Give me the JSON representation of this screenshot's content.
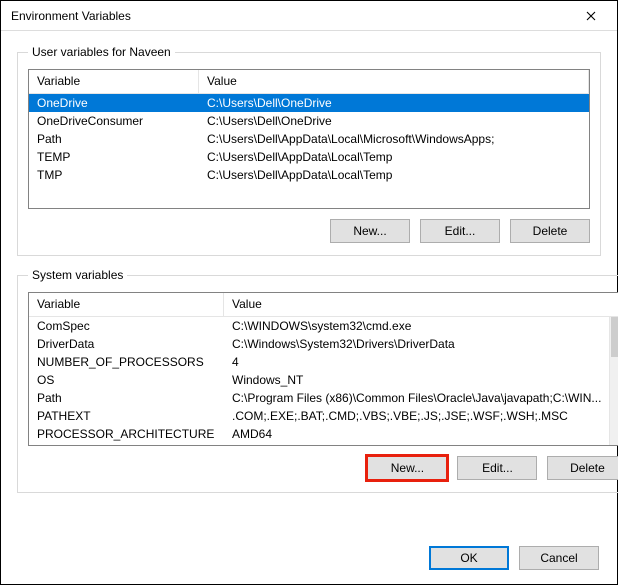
{
  "window": {
    "title": "Environment Variables"
  },
  "userGroup": {
    "legend": "User variables for Naveen",
    "headers": {
      "variable": "Variable",
      "value": "Value"
    },
    "rows": [
      {
        "variable": "OneDrive",
        "value": "C:\\Users\\Dell\\OneDrive",
        "selected": true
      },
      {
        "variable": "OneDriveConsumer",
        "value": "C:\\Users\\Dell\\OneDrive",
        "selected": false
      },
      {
        "variable": "Path",
        "value": "C:\\Users\\Dell\\AppData\\Local\\Microsoft\\WindowsApps;",
        "selected": false
      },
      {
        "variable": "TEMP",
        "value": "C:\\Users\\Dell\\AppData\\Local\\Temp",
        "selected": false
      },
      {
        "variable": "TMP",
        "value": "C:\\Users\\Dell\\AppData\\Local\\Temp",
        "selected": false
      }
    ],
    "buttons": {
      "new": "New...",
      "edit": "Edit...",
      "delete": "Delete"
    }
  },
  "systemGroup": {
    "legend": "System variables",
    "headers": {
      "variable": "Variable",
      "value": "Value"
    },
    "rows": [
      {
        "variable": "ComSpec",
        "value": "C:\\WINDOWS\\system32\\cmd.exe"
      },
      {
        "variable": "DriverData",
        "value": "C:\\Windows\\System32\\Drivers\\DriverData"
      },
      {
        "variable": "NUMBER_OF_PROCESSORS",
        "value": "4"
      },
      {
        "variable": "OS",
        "value": "Windows_NT"
      },
      {
        "variable": "Path",
        "value": "C:\\Program Files (x86)\\Common Files\\Oracle\\Java\\javapath;C:\\WIN..."
      },
      {
        "variable": "PATHEXT",
        "value": ".COM;.EXE;.BAT;.CMD;.VBS;.VBE;.JS;.JSE;.WSF;.WSH;.MSC"
      },
      {
        "variable": "PROCESSOR_ARCHITECTURE",
        "value": "AMD64"
      }
    ],
    "buttons": {
      "new": "New...",
      "edit": "Edit...",
      "delete": "Delete"
    }
  },
  "footer": {
    "ok": "OK",
    "cancel": "Cancel"
  }
}
